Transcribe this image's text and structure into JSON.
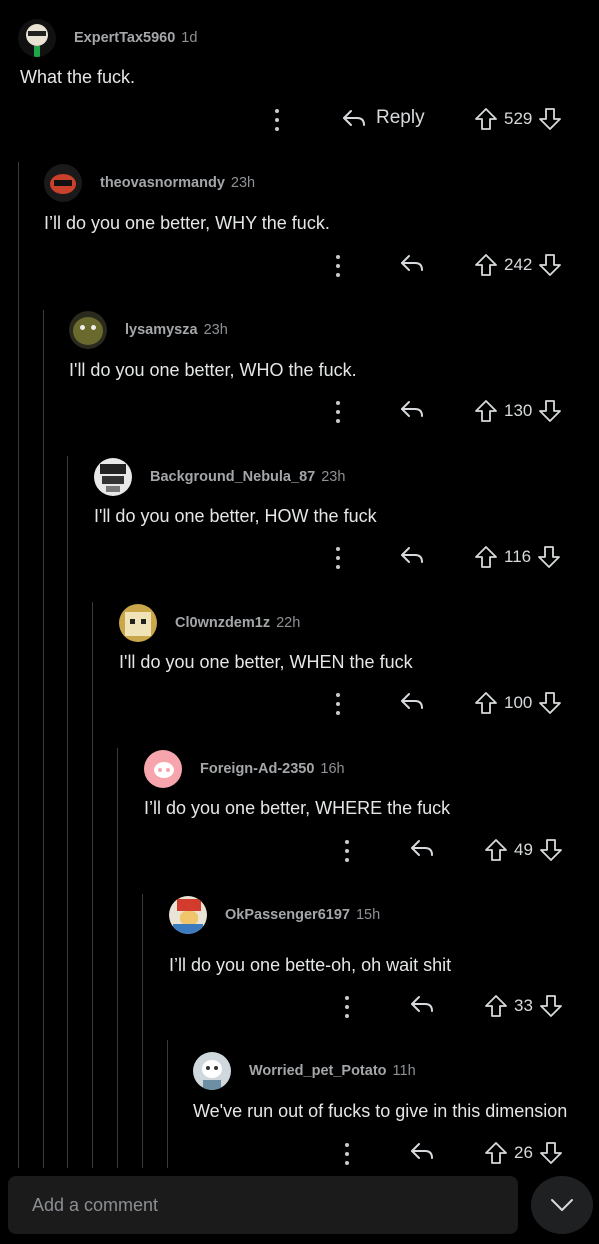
{
  "comments": [
    {
      "username": "ExpertTax5960",
      "age": "1d",
      "body": "What the fuck.",
      "reply_label": "Reply",
      "votes": "529"
    },
    {
      "username": "theovasnormandy",
      "age": "23h",
      "body": "I’ll do you one better, WHY the fuck.",
      "reply_label": "",
      "votes": "242"
    },
    {
      "username": "lysamysza",
      "age": "23h",
      "body": "I'll do you one better, WHO the fuck.",
      "reply_label": "",
      "votes": "130"
    },
    {
      "username": "Background_Nebula_87",
      "age": "23h",
      "body": "I'll do you one better, HOW the fuck",
      "reply_label": "",
      "votes": "116"
    },
    {
      "username": "Cl0wnzdem1z",
      "age": "22h",
      "body": "I'll do you one better, WHEN the fuck",
      "reply_label": "",
      "votes": "100"
    },
    {
      "username": "Foreign-Ad-2350",
      "age": "16h",
      "body": "I’ll do you one better, WHERE the fuck",
      "reply_label": "",
      "votes": "49"
    },
    {
      "username": "OkPassenger6197",
      "age": "15h",
      "body": "I’ll do you one bette-oh, oh wait shit",
      "reply_label": "",
      "votes": "33"
    },
    {
      "username": "Worried_pet_Potato",
      "age": "11h",
      "body": "We've run out of fucks to give in this dimension",
      "reply_label": "",
      "votes": "26"
    }
  ],
  "composer": {
    "placeholder": "Add a comment"
  },
  "icons": {
    "more": "more-vertical-icon",
    "reply": "reply-arrow-icon",
    "upvote": "upvote-arrow-icon",
    "downvote": "downvote-arrow-icon",
    "collapse": "chevron-down-icon"
  },
  "colors": {
    "background": "#000000",
    "text": "#d7dadc",
    "thread_line": "#3a3a3c",
    "input_bg": "#1b1b1c"
  }
}
